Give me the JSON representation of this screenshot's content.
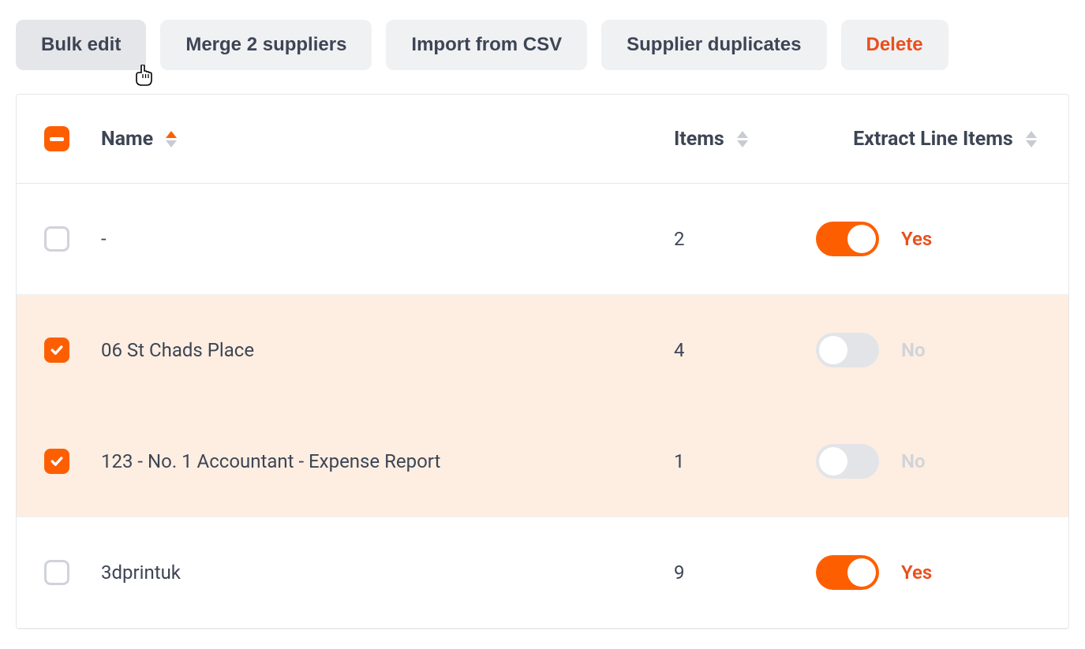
{
  "toolbar": {
    "bulk_edit": "Bulk edit",
    "merge": "Merge 2 suppliers",
    "import_csv": "Import from CSV",
    "duplicates": "Supplier duplicates",
    "delete": "Delete"
  },
  "headers": {
    "name": "Name",
    "items": "Items",
    "extract": "Extract Line Items"
  },
  "labels": {
    "yes": "Yes",
    "no": "No"
  },
  "rows": [
    {
      "name": "-",
      "items": "2",
      "selected": false,
      "extract": true
    },
    {
      "name": "06 St Chads Place",
      "items": "4",
      "selected": true,
      "extract": false
    },
    {
      "name": "123 - No. 1 Accountant - Expense Report",
      "items": "1",
      "selected": true,
      "extract": false
    },
    {
      "name": "3dprintuk",
      "items": "9",
      "selected": false,
      "extract": true
    }
  ]
}
